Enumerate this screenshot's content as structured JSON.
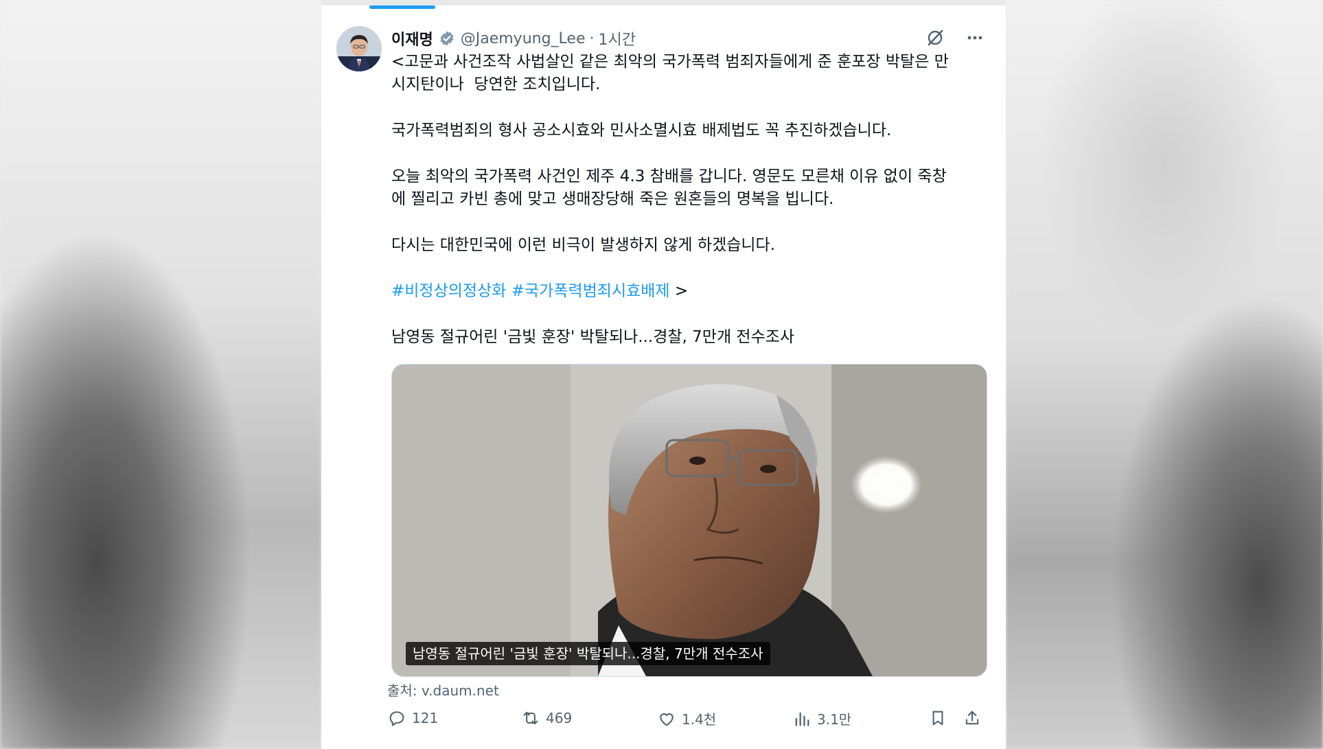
{
  "tweet": {
    "author": {
      "display_name": "이재명",
      "handle": "@Jaemyung_Lee",
      "separator": "·",
      "time": "1시간",
      "verified": true,
      "avatar_icon": "profile-photo"
    },
    "top_icons": [
      "grok-icon",
      "more-icon"
    ],
    "paragraphs": [
      "<고문과 사건조작 사법살인 같은 최악의 국가폭력 범죄자들에게 준 훈포장 박탈은 만\n시지탄이나  당연한 조치입니다.",
      "국가폭력범죄의 형사 공소시효와 민사소멸시효 배제법도 꼭 추진하겠습니다.",
      "오늘 최악의 국가폭력 사건인 제주 4.3 참배를 갑니다. 영문도 모른채 이유 없이 죽창\n에 찔리고 카빈 총에 맞고 생매장당해 죽은 원혼들의 명복을 빕니다.",
      "다시는 대한민국에 이런 비극이 발생하지 않게 하겠습니다."
    ],
    "hashtags": [
      "#비정상의정상화",
      "#국가폭력범죄시효배제"
    ],
    "hashtag_suffix": " >",
    "link_title": "남영동 절규어린 '금빛 훈장' 박탈되나...경찰, 7만개 전수조사",
    "media_caption": "남영동 절규어린 '금빛 훈장' 박탈되나...경찰, 7만개 전수조사",
    "source": "출처: v.daum.net",
    "actions": {
      "replies": "121",
      "reposts": "469",
      "likes": "1.4천",
      "views": "3.1만"
    },
    "accent_color": "#1d9bf0"
  }
}
